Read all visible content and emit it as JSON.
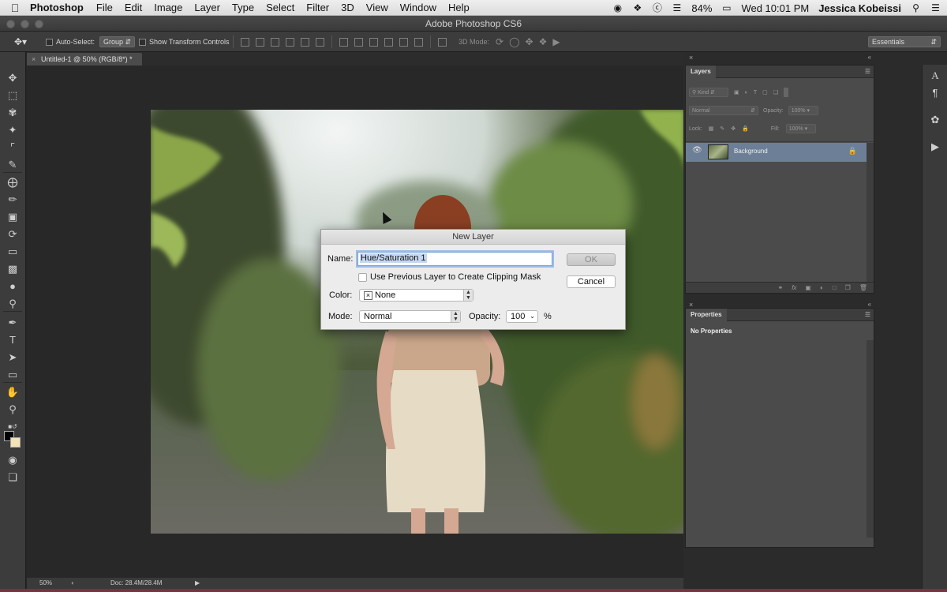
{
  "menubar": {
    "app_name": "Photoshop",
    "menus": [
      "File",
      "Edit",
      "Image",
      "Layer",
      "Type",
      "Select",
      "Filter",
      "3D",
      "View",
      "Window",
      "Help"
    ],
    "battery": "84%",
    "clock": "Wed 10:01 PM",
    "user": "Jessica Kobeissi"
  },
  "window": {
    "title": "Adobe Photoshop CS6"
  },
  "options_bar": {
    "auto_select_label": "Auto-Select:",
    "auto_select_value": "Group",
    "transform_label": "Show Transform Controls",
    "mode_3d_label": "3D Mode:",
    "workspace": "Essentials"
  },
  "document": {
    "tab_title": "Untitled-1 @ 50% (RGB/8*) *",
    "zoom": "50%",
    "doc_size": "Doc: 28.4M/28.4M"
  },
  "layers_panel": {
    "title": "Layers",
    "filter_kind": "Kind",
    "blend_mode": "Normal",
    "opacity_label": "Opacity:",
    "opacity_value": "100%",
    "lock_label": "Lock:",
    "fill_label": "Fill:",
    "fill_value": "100%",
    "layers": [
      {
        "name": "Background",
        "visible": true,
        "locked": true
      }
    ]
  },
  "properties_panel": {
    "title": "Properties",
    "message": "No Properties"
  },
  "dialog": {
    "title": "New Layer",
    "name_label": "Name:",
    "name_value": "Hue/Saturation 1",
    "clipping_label": "Use Previous Layer to Create Clipping Mask",
    "color_label": "Color:",
    "color_value": "None",
    "mode_label": "Mode:",
    "mode_value": "Normal",
    "opacity_label": "Opacity:",
    "opacity_value": "100",
    "opacity_unit": "%",
    "ok_label": "OK",
    "cancel_label": "Cancel"
  },
  "colors": {
    "ui_dark": "#3c3c3c",
    "canvas_bg": "#282828",
    "layer_selected": "#6d7f96"
  }
}
